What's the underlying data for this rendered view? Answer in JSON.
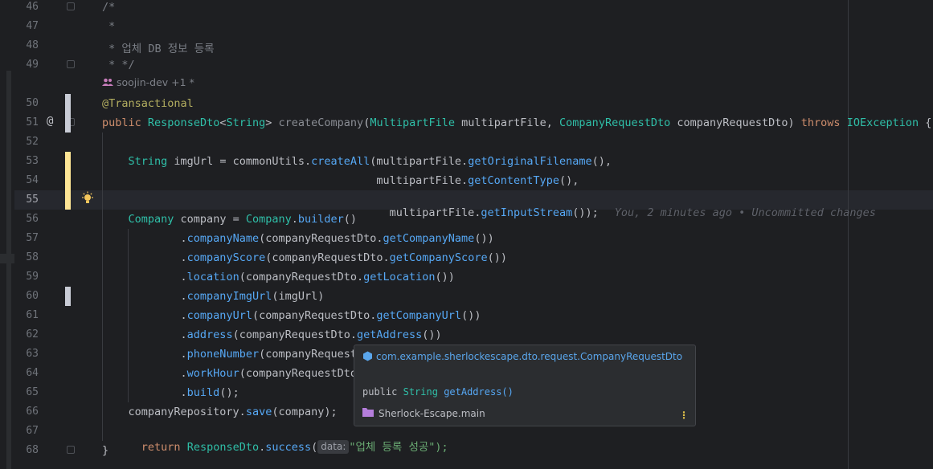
{
  "lines": [
    {
      "n": "46",
      "text": "/*"
    },
    {
      "n": "47",
      "text": " *"
    },
    {
      "n": "48",
      "text": " * 업체 DB 정보 등록"
    },
    {
      "n": "49",
      "text": " * */"
    },
    {
      "n": "50",
      "text": "@Transactional"
    },
    {
      "n": "51",
      "text": "public ResponseDto<String> createCompany(MultipartFile multipartFile, CompanyRequestDto companyRequestDto) throws IOException {"
    },
    {
      "n": "52",
      "text": ""
    },
    {
      "n": "53",
      "text": "    String imgUrl = commonUtils.createAll(multipartFile.getOriginalFilename(),"
    },
    {
      "n": "54",
      "text": "                                          multipartFile.getContentType(),"
    },
    {
      "n": "55",
      "text": "                                          multipartFile.getInputStream());"
    },
    {
      "n": "56",
      "text": "    Company company = Company.builder()"
    },
    {
      "n": "57",
      "text": "            .companyName(companyRequestDto.getCompanyName())"
    },
    {
      "n": "58",
      "text": "            .companyScore(companyRequestDto.getCompanyScore())"
    },
    {
      "n": "59",
      "text": "            .location(companyRequestDto.getLocation())"
    },
    {
      "n": "60",
      "text": "            .companyImgUrl(imgUrl)"
    },
    {
      "n": "61",
      "text": "            .companyUrl(companyRequestDto.getCompanyUrl())"
    },
    {
      "n": "62",
      "text": "            .address(companyRequestDto.getAddress())"
    },
    {
      "n": "63",
      "text": "            .phoneNumber(companyRequest"
    },
    {
      "n": "64",
      "text": "            .workHour(companyRequestDto"
    },
    {
      "n": "65",
      "text": "            .build();"
    },
    {
      "n": "66",
      "text": "    companyRepository.save(company);"
    },
    {
      "n": "67",
      "text": "    return ResponseDto.success("
    },
    {
      "n": "68",
      "text": "}"
    }
  ],
  "author_hint": "soojin-dev +1 *",
  "override_marker": "@",
  "blame": "You, 2 minutes ago • Uncommitted changes",
  "param_hint": "data:",
  "line67_string": "\"업체 등록 성공\");",
  "popup": {
    "package": "com.example.sherlockescape.dto.request.CompanyRequestDto",
    "sig_public": "public",
    "sig_type": "String",
    "sig_method": "getAddress()",
    "module": "Sherlock-Escape.main",
    "more": "⋮"
  }
}
